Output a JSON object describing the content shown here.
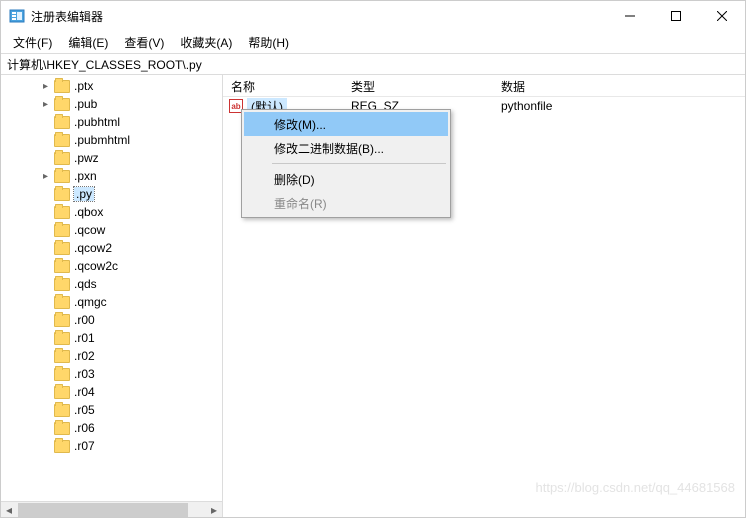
{
  "window": {
    "title": "注册表编辑器"
  },
  "menu": {
    "file": "文件(F)",
    "edit": "编辑(E)",
    "view": "查看(V)",
    "favorites": "收藏夹(A)",
    "help": "帮助(H)"
  },
  "address": "计算机\\HKEY_CLASSES_ROOT\\.py",
  "columns": {
    "name": "名称",
    "type": "类型",
    "data": "数据"
  },
  "tree": [
    {
      "label": ".ptx",
      "expand": ">"
    },
    {
      "label": ".pub",
      "expand": ">"
    },
    {
      "label": ".pubhtml",
      "expand": ""
    },
    {
      "label": ".pubmhtml",
      "expand": ""
    },
    {
      "label": ".pwz",
      "expand": ""
    },
    {
      "label": ".pxn",
      "expand": ">"
    },
    {
      "label": ".py",
      "expand": "",
      "selected": true
    },
    {
      "label": ".qbox",
      "expand": ""
    },
    {
      "label": ".qcow",
      "expand": ""
    },
    {
      "label": ".qcow2",
      "expand": ""
    },
    {
      "label": ".qcow2c",
      "expand": ""
    },
    {
      "label": ".qds",
      "expand": ""
    },
    {
      "label": ".qmgc",
      "expand": ""
    },
    {
      "label": ".r00",
      "expand": ""
    },
    {
      "label": ".r01",
      "expand": ""
    },
    {
      "label": ".r02",
      "expand": ""
    },
    {
      "label": ".r03",
      "expand": ""
    },
    {
      "label": ".r04",
      "expand": ""
    },
    {
      "label": ".r05",
      "expand": ""
    },
    {
      "label": ".r06",
      "expand": ""
    },
    {
      "label": ".r07",
      "expand": ""
    }
  ],
  "values": [
    {
      "name_trunc": "(默认)",
      "type": "REG_SZ",
      "data": "pythonfile"
    }
  ],
  "ctx": {
    "modify": "修改(M)...",
    "modify_binary": "修改二进制数据(B)...",
    "delete": "删除(D)",
    "rename": "重命名(R)"
  },
  "watermark": "https://blog.csdn.net/qq_44681568"
}
